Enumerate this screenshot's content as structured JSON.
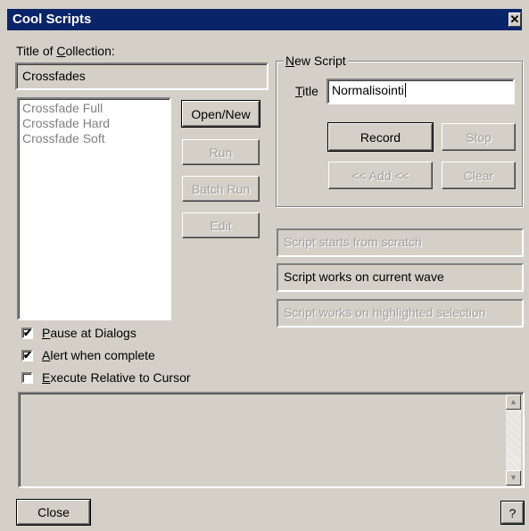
{
  "window": {
    "title": "Cool Scripts",
    "close_glyph": "✕"
  },
  "collection": {
    "label_prefix": "Title of ",
    "label_underlined": "C",
    "label_suffix": "ollection:",
    "value": "Crossfades",
    "items": [
      "Crossfade Full",
      "Crossfade Hard",
      "Crossfade Soft"
    ]
  },
  "buttons": {
    "open_new": "Open/New",
    "run": "Run",
    "batch_run": "Batch Run",
    "edit": "Edit",
    "record": "Record",
    "stop": "Stop",
    "add": "<< Add <<",
    "clear": "Clear",
    "close": "Close",
    "help": "?"
  },
  "new_script": {
    "legend_underlined": "N",
    "legend_rest": "ew Script",
    "title_underlined": "T",
    "title_rest": "itle",
    "title_value": "Normalisointi"
  },
  "script_options": [
    "Script starts from scratch",
    "Script works on current wave",
    "Script works on highlighted selection"
  ],
  "checkboxes": {
    "pause": {
      "underlined": "P",
      "rest": "ause at Dialogs",
      "checked": true
    },
    "alert": {
      "underlined": "A",
      "rest": "lert when complete",
      "checked": true
    },
    "execute": {
      "underlined": "E",
      "rest": "xecute Relative to Cursor",
      "checked": false
    }
  },
  "icons": {
    "check": "✔",
    "scroll_up": "▲",
    "scroll_down": "▼"
  }
}
